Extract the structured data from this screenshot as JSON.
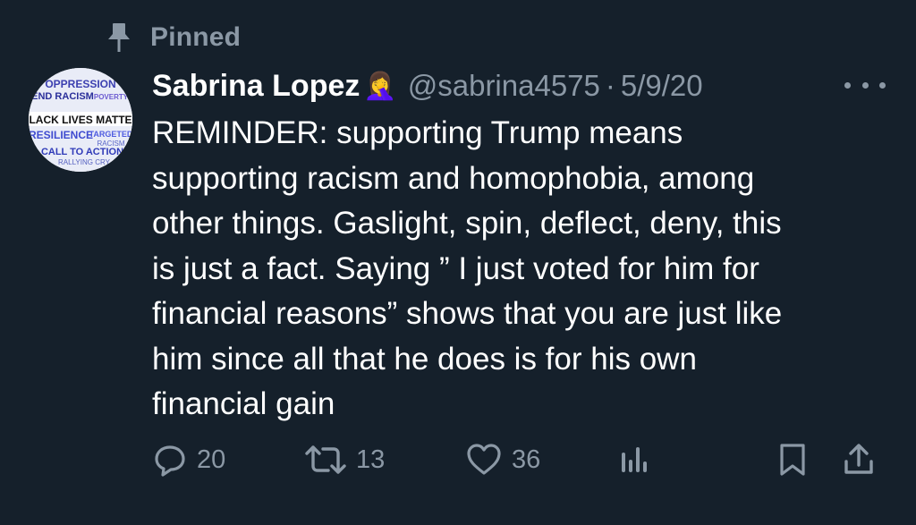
{
  "pinned": {
    "label": "Pinned",
    "icon": "pin-icon"
  },
  "author": {
    "display_name": "Sabrina Lopez",
    "emoji": "🤦‍♀️",
    "handle": "@sabrina4575",
    "separator": "·",
    "date": "5/9/20",
    "avatar_words": [
      "OPPRESSION",
      "END RACISM",
      "POVERTY",
      "BLACK LIVES MATTER",
      "RESILIENCE",
      "TARGETED",
      "RACISM",
      "CALL TO ACTION",
      "RALLYING CRY"
    ]
  },
  "tweet": {
    "text": "REMINDER: supporting Trump means\nsupporting racism and homophobia, among\nother things. Gaslight, spin, deflect, deny, this\nis just a fact. Saying ” I just voted for him for\nfinancial reasons” shows that you are just like\nhim since all that he does is for his own\nfinancial gain"
  },
  "actions": {
    "reply_count": "20",
    "retweet_count": "13",
    "like_count": "36"
  },
  "colors": {
    "background": "#15202b",
    "primary_text": "#ffffff",
    "secondary_text": "#8b98a5"
  }
}
